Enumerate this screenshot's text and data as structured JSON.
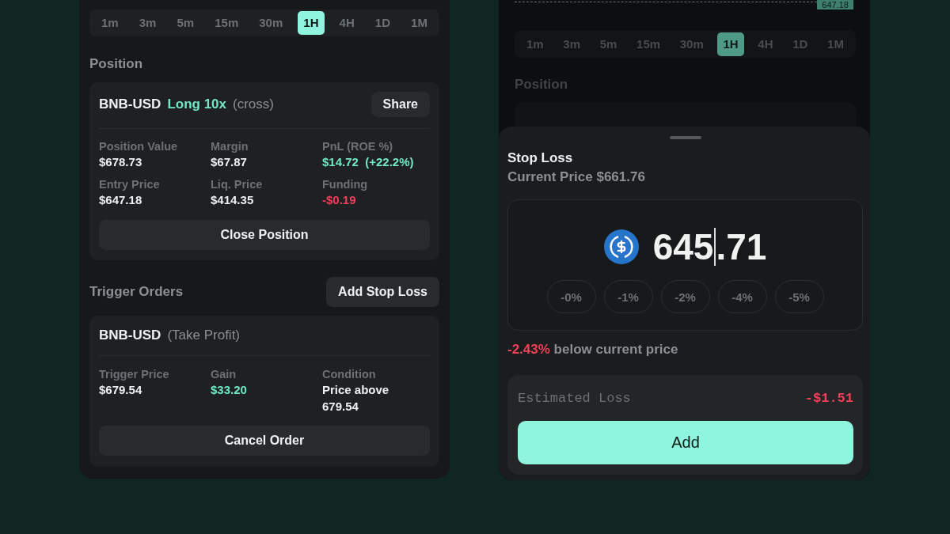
{
  "left_panel": {
    "timeframes": [
      {
        "label": "1m",
        "selected": false
      },
      {
        "label": "3m",
        "selected": false
      },
      {
        "label": "5m",
        "selected": false
      },
      {
        "label": "15m",
        "selected": false
      },
      {
        "label": "30m",
        "selected": false
      },
      {
        "label": "1H",
        "selected": true
      },
      {
        "label": "4H",
        "selected": false
      },
      {
        "label": "1D",
        "selected": false
      },
      {
        "label": "1M",
        "selected": false
      }
    ],
    "position": {
      "heading": "Position",
      "symbol": "BNB-USD",
      "side": "Long 10x",
      "margin_mode": "(cross)",
      "share_button": "Share",
      "stats": [
        {
          "label": "Position Value",
          "value": "$678.73",
          "color": "#eef0f1"
        },
        {
          "label": "Margin",
          "value": "$67.87",
          "color": "#eef0f1"
        },
        {
          "label": "PnL (ROE %)",
          "value": "$14.72  (+22.2%)",
          "color": "#72e8c6"
        },
        {
          "label": "Entry Price",
          "value": "$647.18",
          "color": "#eef0f1"
        },
        {
          "label": "Liq. Price",
          "value": "$414.35",
          "color": "#eef0f1"
        },
        {
          "label": "Funding",
          "value": "-$0.19",
          "color": "#ee4059"
        }
      ],
      "close_button": "Close Position"
    },
    "trigger_orders": {
      "heading": "Trigger Orders",
      "add_button": "Add Stop Loss",
      "orders": [
        {
          "symbol": "BNB-USD",
          "order_type": "(Take Profit)",
          "stats": [
            {
              "label": "Trigger Price",
              "value": "$679.54",
              "color": "#eef0f1"
            },
            {
              "label": "Gain",
              "value": "$33.20",
              "color": "#72e8c6"
            },
            {
              "label": "Condition",
              "value": "Price above 679.54",
              "color": "#eef0f1"
            }
          ],
          "cancel_button": "Cancel Order"
        }
      ]
    }
  },
  "right_panel": {
    "chart": {
      "price_tag": "647.18"
    },
    "timeframes": [
      {
        "label": "1m",
        "selected": false
      },
      {
        "label": "3m",
        "selected": false
      },
      {
        "label": "5m",
        "selected": false
      },
      {
        "label": "15m",
        "selected": false
      },
      {
        "label": "30m",
        "selected": false
      },
      {
        "label": "1H",
        "selected": true
      },
      {
        "label": "4H",
        "selected": false
      },
      {
        "label": "1D",
        "selected": false
      },
      {
        "label": "1M",
        "selected": false
      }
    ],
    "position": {
      "heading": "Position"
    },
    "stop_loss_sheet": {
      "title": "Stop Loss",
      "current_price": "Current Price $661.76",
      "price_input": {
        "value": "645.71"
      },
      "presets": [
        "-0%",
        "-1%",
        "-2%",
        "-4%",
        "-5%"
      ],
      "change_note": "**-2.43%** below current price",
      "estimate": {
        "label": "Estimated Loss",
        "value": "-$1.51"
      },
      "add_button": "Add"
    }
  }
}
